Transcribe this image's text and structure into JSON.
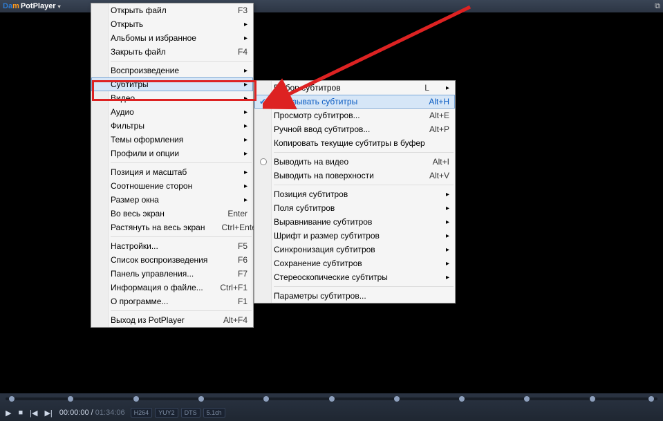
{
  "title": {
    "left": "Da",
    "mid": "m",
    "app": "PotPlayer"
  },
  "menu1": {
    "open_file": "Открыть файл",
    "open": "Открыть",
    "albums": "Альбомы и избранное",
    "close_file": "Закрыть файл",
    "playback": "Воспроизведение",
    "subtitles": "Субтитры",
    "video": "Видео",
    "audio": "Аудио",
    "filters": "Фильтры",
    "skins": "Темы оформления",
    "profiles": "Профили и опции",
    "pos_scale": "Позиция и масштаб",
    "aspect": "Соотношение сторон",
    "winsize": "Размер окна",
    "fullscreen": "Во весь экран",
    "stretch": "Растянуть на весь экран",
    "prefs": "Настройки...",
    "playlist": "Список воспроизведения",
    "ctrl_panel": "Панель управления...",
    "file_info": "Информация о файле...",
    "about": "О программе...",
    "exit": "Выход из PotPlayer",
    "sc": {
      "f3": "F3",
      "f4": "F4",
      "enter": "Enter",
      "ctrl_enter": "Ctrl+Enter",
      "f5": "F5",
      "f6": "F6",
      "f7": "F7",
      "ctrl_f1": "Ctrl+F1",
      "f1": "F1",
      "alt_f4": "Alt+F4"
    }
  },
  "menu2": {
    "select": "Выбор субтитров",
    "show": "Показывать субтитры",
    "browse": "Просмотр субтитров...",
    "manual": "Ручной ввод субтитров...",
    "copybuf": "Копировать текущие субтитры в буфер",
    "on_video": "Выводить на видео",
    "on_surface": "Выводить на поверхности",
    "position": "Позиция субтитров",
    "margins": "Поля субтитров",
    "align": "Выравнивание субтитров",
    "font": "Шрифт и размер субтитров",
    "sync": "Синхронизация субтитров",
    "save": "Сохранение субтитров",
    "stereo": "Стереоскопические субтитры",
    "params": "Параметры субтитров...",
    "sc": {
      "l": "L",
      "alt_h": "Alt+H",
      "alt_e": "Alt+E",
      "alt_p": "Alt+P",
      "alt_i": "Alt+I",
      "alt_v": "Alt+V"
    }
  },
  "time": {
    "cur": "00:00:00",
    "total": "01:34:06"
  },
  "codecs": [
    "H264",
    "YUY2",
    "DTS",
    "5.1ch"
  ]
}
